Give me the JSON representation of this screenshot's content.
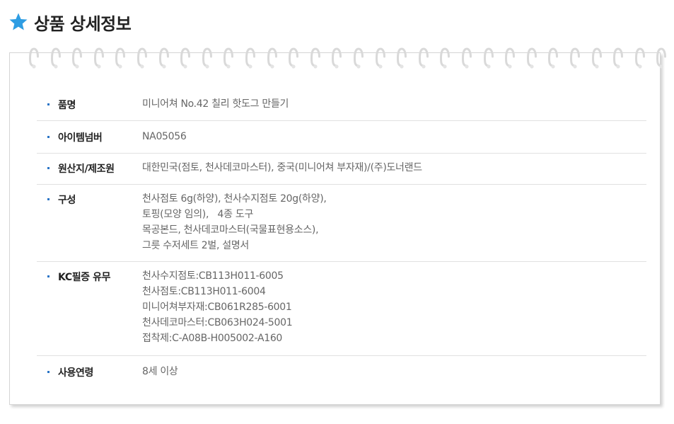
{
  "header": {
    "icon": "star-icon",
    "icon_color": "#2e9de3",
    "title": "상품 상세정보"
  },
  "details": {
    "rows": [
      {
        "label": "품명",
        "lines": [
          "미니어쳐 No.42 칠리 핫도그 만들기"
        ]
      },
      {
        "label": "아이템넘버",
        "lines": [
          "NA05056"
        ]
      },
      {
        "label": "원산지/제조원",
        "lines": [
          "대한민국(점토, 천사데코마스터), 중국(미니어쳐 부자재)/(주)도너랜드"
        ]
      },
      {
        "label": "구성",
        "lines": [
          "천사점토 6g(하양), 천사수지점토 20g(하양),",
          "토핑(모양 임의),   4종 도구",
          "목공본드, 천사데코마스터(국물표현용소스),",
          "그릇 수저세트 2벌, 설명서"
        ]
      },
      {
        "label": "KC필증 유무",
        "lines": [
          "천사수지점토:CB113H011-6005",
          "천사점토:CB113H011-6004",
          "미니어쳐부자재:CB061R285-6001",
          "천사데코마스터:CB063H024-5001",
          "접착제:C-A08B-H005002-A160"
        ]
      },
      {
        "label": "사용연령",
        "lines": [
          "8세 이상"
        ]
      }
    ]
  },
  "colors": {
    "bullet": "#2a74c6",
    "label": "#222222",
    "value": "#666666",
    "divider": "#e1e1e1"
  }
}
